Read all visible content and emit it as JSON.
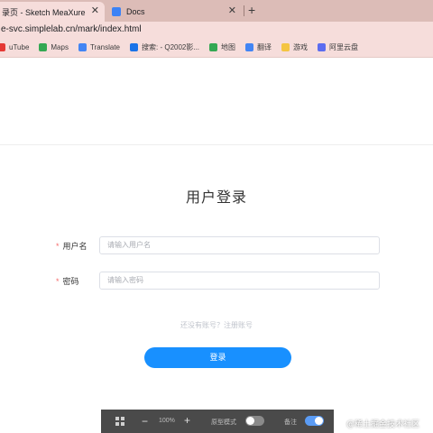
{
  "browser": {
    "tabs": [
      {
        "title": "录页 - Sketch MeaXure",
        "active": true
      },
      {
        "title": "Docs",
        "active": false
      }
    ],
    "new_tab": "+",
    "close_glyph": "✕",
    "address": "e-svc.simplelab.cn/mark/index.html",
    "bookmarks": [
      {
        "label": "uTube",
        "icon": "youtube-icon",
        "color": "#e53935"
      },
      {
        "label": "Maps",
        "icon": "maps-icon",
        "color": "#34a853"
      },
      {
        "label": "Translate",
        "icon": "translate-icon",
        "color": "#4285f4"
      },
      {
        "label": "搜索: - Q2002影...",
        "icon": "search-bookmark-icon",
        "color": "#1a73e8"
      },
      {
        "label": "地图",
        "icon": "map-icon",
        "color": "#34a853"
      },
      {
        "label": "翻译",
        "icon": "translate-icon",
        "color": "#4285f4"
      },
      {
        "label": "游戏",
        "icon": "folder-icon",
        "color": "#f4c542"
      },
      {
        "label": "阿里云盘",
        "icon": "aliyun-drive-icon",
        "color": "#5b6cf0"
      }
    ]
  },
  "login": {
    "title": "用户登录",
    "username_label": "用户名",
    "username_placeholder": "请输入用户名",
    "password_label": "密码",
    "password_placeholder": "请输入密码",
    "required_mark": "*",
    "register_text": "还没有账号？注册账号",
    "submit_label": "登录",
    "accent_color": "#1890ff"
  },
  "toolbar": {
    "minus": "−",
    "zoom": "100%",
    "plus": "+",
    "prototype_label": "原型模式",
    "prototype_on": false,
    "note_label": "备注",
    "note_on": true
  },
  "watermark": "@稀土掘金技术社区"
}
